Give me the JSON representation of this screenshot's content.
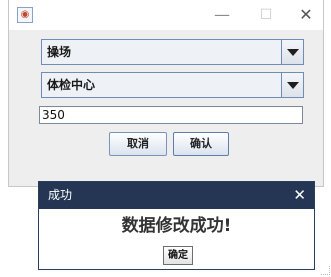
{
  "main_window": {
    "icon": "app-icon",
    "controls": {
      "minimize": "—",
      "maximize": "☐",
      "close": "✕"
    },
    "combo1": {
      "value": "操场"
    },
    "combo2": {
      "value": "体检中心"
    },
    "text_field": {
      "value": "350"
    },
    "cancel_label": "取消",
    "confirm_label": "确认"
  },
  "dialog": {
    "title": "成功",
    "close": "✕",
    "message": "数据修改成功!",
    "ok_label": "确定"
  }
}
